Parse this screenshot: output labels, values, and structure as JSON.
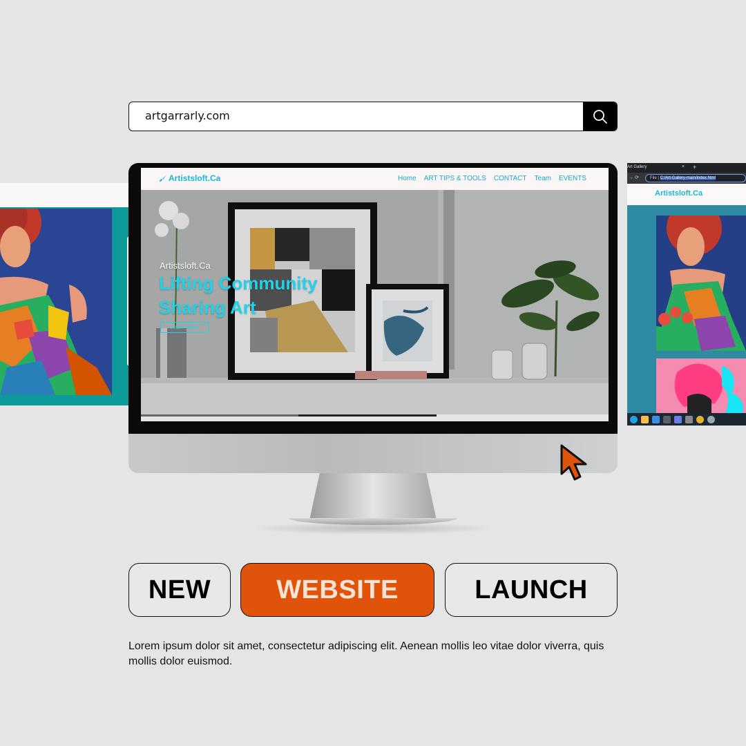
{
  "search": {
    "query": "artgarrarly.com",
    "button_icon": "search-icon"
  },
  "site": {
    "logo": "Artistsloft.Ca",
    "nav": [
      "Home",
      "ART TIPS & TOOLS",
      "CONTACT",
      "Team",
      "EVENTS"
    ],
    "hero_subtitle": "Artistsloft.Ca",
    "hero_title": "Lifting Community Sharing Art",
    "hero_button": "Learn More"
  },
  "side_browser": {
    "tab_title": "Art Gallery",
    "address_label": "File",
    "address_value": "C:/Art-Gallery-main/index.html",
    "logo": "Artistsloft.Ca"
  },
  "buttons": {
    "new": "NEW",
    "website": "WEBSITE",
    "launch": "LAUNCH"
  },
  "caption": "Lorem ipsum dolor sit amet, consectetur adipiscing elit. Aenean mollis leo vitae dolor viverra, quis mollis dolor euismod.",
  "colors": {
    "background": "#e5e5e5",
    "accent_orange": "#e0530b",
    "site_teal": "#17b7d6",
    "panel_teal": "#0f9a9a"
  }
}
